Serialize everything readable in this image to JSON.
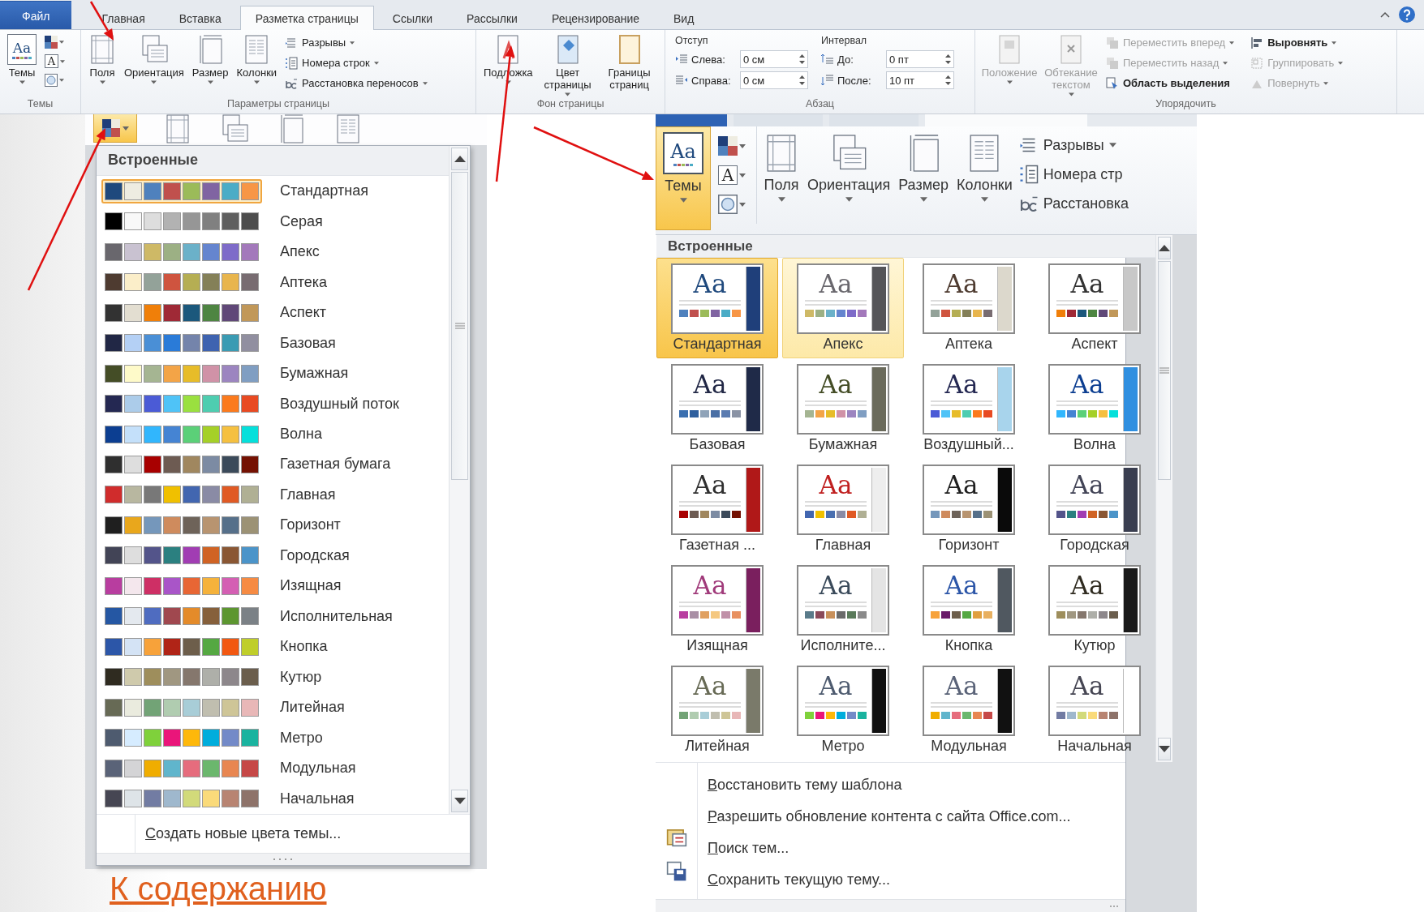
{
  "ribbon": {
    "tabs": [
      {
        "label": "Файл",
        "kind": "file",
        "selected": false
      },
      {
        "label": "Главная",
        "kind": "tab",
        "selected": false
      },
      {
        "label": "Вставка",
        "kind": "tab",
        "selected": false
      },
      {
        "label": "Разметка страницы",
        "kind": "tab",
        "selected": true
      },
      {
        "label": "Ссылки",
        "kind": "tab",
        "selected": false
      },
      {
        "label": "Рассылки",
        "kind": "tab",
        "selected": false
      },
      {
        "label": "Рецензирование",
        "kind": "tab",
        "selected": false
      },
      {
        "label": "Вид",
        "kind": "tab",
        "selected": false
      }
    ],
    "groups": [
      {
        "kind": "themes",
        "label": "Темы",
        "button": {
          "label": "Темы",
          "icon_text": "Aa"
        },
        "font_icon_text": "A"
      },
      {
        "kind": "page_setup",
        "label": "Параметры страницы",
        "big": [
          {
            "label": "Поля",
            "kind": "margins",
            "dropdown": true
          },
          {
            "label": "Ориентация",
            "kind": "orientation",
            "dropdown": true
          },
          {
            "label": "Размер",
            "kind": "size",
            "dropdown": true
          },
          {
            "label": "Колонки",
            "kind": "columns",
            "dropdown": true
          }
        ],
        "small": [
          {
            "label": "Разрывы",
            "kind": "breaks",
            "dropdown": true,
            "disabled": false
          },
          {
            "label": "Номера строк",
            "kind": "line_numbers",
            "dropdown": true,
            "disabled": false
          },
          {
            "label": "Расстановка переносов",
            "kind": "hyphenation",
            "dropdown": true,
            "disabled": false
          }
        ]
      },
      {
        "kind": "background",
        "label": "Фон страницы",
        "big": [
          {
            "label": "Подложка",
            "kind": "watermark",
            "dropdown": true
          },
          {
            "label": "Цвет страницы",
            "kind": "page_color",
            "dropdown": true
          },
          {
            "label": "Границы страниц",
            "kind": "page_borders",
            "dropdown": false
          }
        ]
      },
      {
        "kind": "paragraph",
        "label": "Абзац",
        "indent": {
          "title": "Отступ",
          "fields": [
            {
              "label": "Слева:",
              "kind": "indent_left",
              "value": "0 см"
            },
            {
              "label": "Справа:",
              "kind": "indent_right",
              "value": "0 см"
            }
          ]
        },
        "spacing": {
          "title": "Интервал",
          "fields": [
            {
              "label": "До:",
              "kind": "space_before",
              "value": "0 пт"
            },
            {
              "label": "После:",
              "kind": "space_after",
              "value": "10 пт"
            }
          ]
        }
      },
      {
        "kind": "arrange",
        "label": "Упорядочить",
        "big": [
          {
            "label": "Положение",
            "kind": "position",
            "dropdown": true,
            "disabled": true
          },
          {
            "label": "Обтекание текстом",
            "kind": "wrap",
            "dropdown": true,
            "disabled": true
          }
        ],
        "small": [
          {
            "label": "Переместить вперед",
            "kind": "forward",
            "dropdown": true,
            "disabled": true
          },
          {
            "label": "Переместить назад",
            "kind": "backward",
            "dropdown": true,
            "disabled": true
          },
          {
            "label": "Область выделения",
            "kind": "selection",
            "dropdown": false,
            "disabled": false
          },
          {
            "label": "Выровнять",
            "kind": "align",
            "dropdown": true,
            "disabled": false
          },
          {
            "label": "Группировать",
            "kind": "group",
            "dropdown": true,
            "disabled": true
          },
          {
            "label": "Повернуть",
            "kind": "rotate",
            "dropdown": true,
            "disabled": true
          }
        ]
      }
    ]
  },
  "colors_gallery": {
    "colors_button": {
      "pressed": true
    },
    "heading": "Встроенные",
    "schemes": [
      {
        "name": "Стандартная",
        "selected": true,
        "swatches": [
          {
            "color": "#1f497d"
          },
          {
            "color": "#eeece1"
          },
          {
            "color": "#4f81bd"
          },
          {
            "color": "#c0504d"
          },
          {
            "color": "#9bbb59"
          },
          {
            "color": "#8064a2"
          },
          {
            "color": "#4bacc6"
          },
          {
            "color": "#f79646"
          }
        ]
      },
      {
        "name": "Серая",
        "selected": false,
        "swatches": [
          {
            "color": "#000000"
          },
          {
            "color": "#f8f8f8"
          },
          {
            "color": "#dddddd"
          },
          {
            "color": "#b2b2b2"
          },
          {
            "color": "#969696"
          },
          {
            "color": "#808080"
          },
          {
            "color": "#5f5f5f"
          },
          {
            "color": "#4d4d4d"
          }
        ]
      },
      {
        "name": "Апекс",
        "selected": false,
        "swatches": [
          {
            "color": "#69676d"
          },
          {
            "color": "#c9c2d1"
          },
          {
            "color": "#ceb966"
          },
          {
            "color": "#9cb084"
          },
          {
            "color": "#6bb1c9"
          },
          {
            "color": "#6585cf"
          },
          {
            "color": "#7e6bc9"
          },
          {
            "color": "#a379bb"
          }
        ]
      },
      {
        "name": "Аптека",
        "selected": false,
        "swatches": [
          {
            "color": "#4e3b30"
          },
          {
            "color": "#fbeec9"
          },
          {
            "color": "#93a299"
          },
          {
            "color": "#cf543f"
          },
          {
            "color": "#b5ae53"
          },
          {
            "color": "#848058"
          },
          {
            "color": "#e8b54d"
          },
          {
            "color": "#786c71"
          }
        ]
      },
      {
        "name": "Аспект",
        "selected": false,
        "swatches": [
          {
            "color": "#323232"
          },
          {
            "color": "#e3ded1"
          },
          {
            "color": "#f07f09"
          },
          {
            "color": "#9f2936"
          },
          {
            "color": "#1b587c"
          },
          {
            "color": "#4e8542"
          },
          {
            "color": "#604878"
          },
          {
            "color": "#c19859"
          }
        ]
      },
      {
        "name": "Базовая",
        "selected": false,
        "swatches": [
          {
            "color": "#212745"
          },
          {
            "color": "#b4d0f5"
          },
          {
            "color": "#4a8fd6"
          },
          {
            "color": "#2a7bd8"
          },
          {
            "color": "#7484ab"
          },
          {
            "color": "#3e63b0"
          },
          {
            "color": "#3a9bb3"
          },
          {
            "color": "#918fa0"
          }
        ]
      },
      {
        "name": "Бумажная",
        "selected": false,
        "swatches": [
          {
            "color": "#444d26"
          },
          {
            "color": "#fefac9"
          },
          {
            "color": "#a5b592"
          },
          {
            "color": "#f3a447"
          },
          {
            "color": "#e7bc29"
          },
          {
            "color": "#d092a7"
          },
          {
            "color": "#9c85c0"
          },
          {
            "color": "#809ec2"
          }
        ]
      },
      {
        "name": "Воздушный поток",
        "selected": false,
        "swatches": [
          {
            "color": "#242852"
          },
          {
            "color": "#acccea"
          },
          {
            "color": "#4b5bd6"
          },
          {
            "color": "#4fc3f7"
          },
          {
            "color": "#9ae03f"
          },
          {
            "color": "#4ecdb0"
          },
          {
            "color": "#fb7a1d"
          },
          {
            "color": "#e84a22"
          }
        ]
      },
      {
        "name": "Волна",
        "selected": false,
        "swatches": [
          {
            "color": "#0c3e91"
          },
          {
            "color": "#c4e0fa"
          },
          {
            "color": "#31b6fd"
          },
          {
            "color": "#4584d3"
          },
          {
            "color": "#5bd078"
          },
          {
            "color": "#a5d028"
          },
          {
            "color": "#f5c040"
          },
          {
            "color": "#05e0db"
          }
        ]
      },
      {
        "name": "Газетная бумага",
        "selected": false,
        "swatches": [
          {
            "color": "#2f2f2f"
          },
          {
            "color": "#dedede"
          },
          {
            "color": "#a80000"
          },
          {
            "color": "#6d5b52"
          },
          {
            "color": "#a0875f"
          },
          {
            "color": "#7c8ba3"
          },
          {
            "color": "#3b4a5a"
          },
          {
            "color": "#741102"
          }
        ]
      },
      {
        "name": "Главная",
        "selected": false,
        "swatches": [
          {
            "color": "#d02c2c"
          },
          {
            "color": "#b8b7a0"
          },
          {
            "color": "#787878"
          },
          {
            "color": "#f0c000"
          },
          {
            "color": "#4266b0"
          },
          {
            "color": "#8a8ba5"
          },
          {
            "color": "#e05a24"
          },
          {
            "color": "#b0b094"
          }
        ]
      },
      {
        "name": "Горизонт",
        "selected": false,
        "swatches": [
          {
            "color": "#1f1f1f"
          },
          {
            "color": "#e9a71c"
          },
          {
            "color": "#7597bb"
          },
          {
            "color": "#cf8b5d"
          },
          {
            "color": "#6e6359"
          },
          {
            "color": "#b89470"
          },
          {
            "color": "#56708a"
          },
          {
            "color": "#9c9275"
          }
        ]
      },
      {
        "name": "Городская",
        "selected": false,
        "swatches": [
          {
            "color": "#424456"
          },
          {
            "color": "#dedede"
          },
          {
            "color": "#53548a"
          },
          {
            "color": "#2b8080"
          },
          {
            "color": "#a13db3"
          },
          {
            "color": "#d06324"
          },
          {
            "color": "#8a5734"
          },
          {
            "color": "#4b94c9"
          }
        ]
      },
      {
        "name": "Изящная",
        "selected": false,
        "swatches": [
          {
            "color": "#b83d9f"
          },
          {
            "color": "#f4e7ed"
          },
          {
            "color": "#ce2f65"
          },
          {
            "color": "#a955c8"
          },
          {
            "color": "#e86634"
          },
          {
            "color": "#f5b23b"
          },
          {
            "color": "#d45fb3"
          },
          {
            "color": "#f68b43"
          }
        ]
      },
      {
        "name": "Исполнительная",
        "selected": false,
        "swatches": [
          {
            "color": "#2557a3"
          },
          {
            "color": "#e4e9ef"
          },
          {
            "color": "#4f6cc0"
          },
          {
            "color": "#a0484f"
          },
          {
            "color": "#e48b2a"
          },
          {
            "color": "#86603b"
          },
          {
            "color": "#5d9630"
          },
          {
            "color": "#7b8186"
          }
        ]
      },
      {
        "name": "Кнопка",
        "selected": false,
        "swatches": [
          {
            "color": "#2c56a8"
          },
          {
            "color": "#d4e3f5"
          },
          {
            "color": "#f7a23a"
          },
          {
            "color": "#b02417"
          },
          {
            "color": "#6d5e4b"
          },
          {
            "color": "#55a842"
          },
          {
            "color": "#f25811"
          },
          {
            "color": "#bfce2a"
          }
        ]
      },
      {
        "name": "Кутюр",
        "selected": false,
        "swatches": [
          {
            "color": "#2f2b20"
          },
          {
            "color": "#cfcaac"
          },
          {
            "color": "#9e8e5c"
          },
          {
            "color": "#a09781"
          },
          {
            "color": "#85776d"
          },
          {
            "color": "#aeafa9"
          },
          {
            "color": "#8d878b"
          },
          {
            "color": "#6b5e4d"
          }
        ]
      },
      {
        "name": "Литейная",
        "selected": false,
        "swatches": [
          {
            "color": "#676a55"
          },
          {
            "color": "#eaebde"
          },
          {
            "color": "#72a376"
          },
          {
            "color": "#b0ccb0"
          },
          {
            "color": "#a8cdd7"
          },
          {
            "color": "#c0beaf"
          },
          {
            "color": "#cec597"
          },
          {
            "color": "#e8b7b7"
          }
        ]
      },
      {
        "name": "Метро",
        "selected": false,
        "swatches": [
          {
            "color": "#4e5b6f"
          },
          {
            "color": "#d6ecff"
          },
          {
            "color": "#7fd13b"
          },
          {
            "color": "#ea157a"
          },
          {
            "color": "#feb80a"
          },
          {
            "color": "#00addc"
          },
          {
            "color": "#738ac8"
          },
          {
            "color": "#1ab39f"
          }
        ]
      },
      {
        "name": "Модульная",
        "selected": false,
        "swatches": [
          {
            "color": "#5a6378"
          },
          {
            "color": "#d4d4d6"
          },
          {
            "color": "#f0ad00"
          },
          {
            "color": "#60b5cc"
          },
          {
            "color": "#e66c7d"
          },
          {
            "color": "#6bb76d"
          },
          {
            "color": "#e88651"
          },
          {
            "color": "#c64847"
          }
        ]
      },
      {
        "name": "Начальная",
        "selected": false,
        "swatches": [
          {
            "color": "#464653"
          },
          {
            "color": "#dee4e8"
          },
          {
            "color": "#727ca3"
          },
          {
            "color": "#9fb8cd"
          },
          {
            "color": "#d2da7a"
          },
          {
            "color": "#fada7a"
          },
          {
            "color": "#b88472"
          },
          {
            "color": "#8e736a"
          }
        ]
      }
    ],
    "create_command": "Создать новые цвета темы..."
  },
  "themes_gallery": {
    "ribbon": {
      "tabs": [
        {
          "kind": "file",
          "selected": false
        },
        {
          "kind": "tab",
          "selected": false
        },
        {
          "kind": "tab",
          "selected": false
        },
        {
          "kind": "tab",
          "selected": true
        }
      ],
      "themes_button": {
        "label": "Темы",
        "icon_text": "Aa",
        "pressed": true
      },
      "font_icon_text": "A",
      "big": [
        {
          "label": "Поля",
          "kind": "margins"
        },
        {
          "label": "Ориентация",
          "kind": "orientation"
        },
        {
          "label": "Размер",
          "kind": "size"
        },
        {
          "label": "Колонки",
          "kind": "columns"
        }
      ],
      "small": [
        {
          "label": "Разрывы",
          "kind": "breaks",
          "dropdown": true
        },
        {
          "label": "Номера стр",
          "kind": "line_numbers",
          "dropdown": false
        },
        {
          "label": "Расстановка",
          "kind": "hyphenation",
          "dropdown": false
        }
      ]
    },
    "heading": "Встроенные",
    "themes": [
      {
        "name": "Стандартная",
        "selected": true,
        "hovered": false,
        "sample": {
          "text": "Aa",
          "color": "#1f497d"
        },
        "band": {
          "color": "#1f3f7a"
        },
        "swatches": [
          {
            "color": "#4f81bd"
          },
          {
            "color": "#c0504d"
          },
          {
            "color": "#9bbb59"
          },
          {
            "color": "#8064a2"
          },
          {
            "color": "#4bacc6"
          },
          {
            "color": "#f79646"
          }
        ]
      },
      {
        "name": "Апекс",
        "selected": false,
        "hovered": true,
        "sample": {
          "text": "Aa",
          "color": "#69676d"
        },
        "band": {
          "color": "#555558"
        },
        "swatches": [
          {
            "color": "#ceb966"
          },
          {
            "color": "#9cb084"
          },
          {
            "color": "#6bb1c9"
          },
          {
            "color": "#6585cf"
          },
          {
            "color": "#7e6bc9"
          },
          {
            "color": "#a379bb"
          }
        ]
      },
      {
        "name": "Аптека",
        "selected": false,
        "hovered": false,
        "sample": {
          "text": "Aa",
          "color": "#4e3b30"
        },
        "band": {
          "color": "#dcd8cc"
        },
        "swatches": [
          {
            "color": "#93a299"
          },
          {
            "color": "#cf543f"
          },
          {
            "color": "#b5ae53"
          },
          {
            "color": "#848058"
          },
          {
            "color": "#e8b54d"
          },
          {
            "color": "#786c71"
          }
        ]
      },
      {
        "name": "Аспект",
        "selected": false,
        "hovered": false,
        "sample": {
          "text": "Aa",
          "color": "#323232"
        },
        "band": {
          "color": "#c8c8c8"
        },
        "swatches": [
          {
            "color": "#f07f09"
          },
          {
            "color": "#9f2936"
          },
          {
            "color": "#1b587c"
          },
          {
            "color": "#4e8542"
          },
          {
            "color": "#604878"
          },
          {
            "color": "#c19859"
          }
        ]
      },
      {
        "name": "Базовая",
        "selected": false,
        "hovered": false,
        "sample": {
          "text": "Aa",
          "color": "#212745"
        },
        "band": {
          "color": "#1f2a48"
        },
        "swatches": [
          {
            "color": "#3a6fb0"
          },
          {
            "color": "#2f5f9e"
          },
          {
            "color": "#8fa3b8"
          },
          {
            "color": "#4a6fa5"
          },
          {
            "color": "#5a7bb0"
          },
          {
            "color": "#8a93a5"
          }
        ]
      },
      {
        "name": "Бумажная",
        "selected": false,
        "hovered": false,
        "sample": {
          "text": "Aa",
          "color": "#444d26"
        },
        "band": {
          "color": "#6b6b5c"
        },
        "swatches": [
          {
            "color": "#a5b592"
          },
          {
            "color": "#f3a447"
          },
          {
            "color": "#e7bc29"
          },
          {
            "color": "#d092a7"
          },
          {
            "color": "#9c85c0"
          },
          {
            "color": "#809ec2"
          }
        ]
      },
      {
        "name": "Воздушный...",
        "selected": false,
        "hovered": false,
        "sample": {
          "text": "Aa",
          "color": "#242852"
        },
        "band": {
          "color": "#a8d4ec"
        },
        "swatches": [
          {
            "color": "#4b5bd6"
          },
          {
            "color": "#4fc3f7"
          },
          {
            "color": "#e7bc29"
          },
          {
            "color": "#4ecdb0"
          },
          {
            "color": "#fb7a1d"
          },
          {
            "color": "#e84a22"
          }
        ]
      },
      {
        "name": "Волна",
        "selected": false,
        "hovered": false,
        "sample": {
          "text": "Aa",
          "color": "#0c3e91"
        },
        "band": {
          "color": "#2f8fe0"
        },
        "swatches": [
          {
            "color": "#31b6fd"
          },
          {
            "color": "#4584d3"
          },
          {
            "color": "#5bd078"
          },
          {
            "color": "#a5d028"
          },
          {
            "color": "#f5c040"
          },
          {
            "color": "#05e0db"
          }
        ]
      },
      {
        "name": "Газетная ...",
        "selected": false,
        "hovered": false,
        "sample": {
          "text": "Aa",
          "color": "#2f2f2f"
        },
        "band": {
          "color": "#b01818"
        },
        "swatches": [
          {
            "color": "#a80000"
          },
          {
            "color": "#6d5b52"
          },
          {
            "color": "#a0875f"
          },
          {
            "color": "#7c8ba3"
          },
          {
            "color": "#3b4a5a"
          },
          {
            "color": "#741102"
          }
        ]
      },
      {
        "name": "Главная",
        "selected": false,
        "hovered": false,
        "sample": {
          "text": "Aa",
          "color": "#c02020"
        },
        "band": {
          "color": "#eeeeee"
        },
        "swatches": [
          {
            "color": "#4266b0"
          },
          {
            "color": "#f0c000"
          },
          {
            "color": "#4a6fb0"
          },
          {
            "color": "#8a8ba5"
          },
          {
            "color": "#e05a24"
          },
          {
            "color": "#b0b094"
          }
        ]
      },
      {
        "name": "Горизонт",
        "selected": false,
        "hovered": false,
        "sample": {
          "text": "Aa",
          "color": "#1f1f1f"
        },
        "band": {
          "color": "#0a0a0a"
        },
        "swatches": [
          {
            "color": "#7597bb"
          },
          {
            "color": "#cf8b5d"
          },
          {
            "color": "#6e6359"
          },
          {
            "color": "#b89470"
          },
          {
            "color": "#56708a"
          },
          {
            "color": "#9c9275"
          }
        ]
      },
      {
        "name": "Городская",
        "selected": false,
        "hovered": false,
        "sample": {
          "text": "Aa",
          "color": "#424456"
        },
        "band": {
          "color": "#3a3e50"
        },
        "swatches": [
          {
            "color": "#53548a"
          },
          {
            "color": "#2b8080"
          },
          {
            "color": "#a13db3"
          },
          {
            "color": "#d06324"
          },
          {
            "color": "#8a5734"
          },
          {
            "color": "#4b94c9"
          }
        ]
      },
      {
        "name": "Изящная",
        "selected": false,
        "hovered": false,
        "sample": {
          "text": "Aa",
          "color": "#a03a7a"
        },
        "band": {
          "color": "#7a1f5e"
        },
        "swatches": [
          {
            "color": "#b83d9f"
          },
          {
            "color": "#a98fa5"
          },
          {
            "color": "#e0a060"
          },
          {
            "color": "#f5c880"
          },
          {
            "color": "#c090a8"
          },
          {
            "color": "#e89060"
          }
        ]
      },
      {
        "name": "Исполните...",
        "selected": false,
        "hovered": false,
        "sample": {
          "text": "Aa",
          "color": "#3a4a5a"
        },
        "band": {
          "color": "#e4e4e4"
        },
        "swatches": [
          {
            "color": "#5a7b8a"
          },
          {
            "color": "#8a4a5a"
          },
          {
            "color": "#c8905a"
          },
          {
            "color": "#6a6a6a"
          },
          {
            "color": "#5a7a5a"
          },
          {
            "color": "#8a8a8a"
          }
        ]
      },
      {
        "name": "Кнопка",
        "selected": false,
        "hovered": false,
        "sample": {
          "text": "Aa",
          "color": "#2c56a8"
        },
        "band": {
          "color": "#505860"
        },
        "swatches": [
          {
            "color": "#f7a23a"
          },
          {
            "color": "#6a1a6a"
          },
          {
            "color": "#6d5e4b"
          },
          {
            "color": "#55a842"
          },
          {
            "color": "#e0a040"
          },
          {
            "color": "#e8b060"
          }
        ]
      },
      {
        "name": "Кутюр",
        "selected": false,
        "hovered": false,
        "sample": {
          "text": "Aa",
          "color": "#2f2b20"
        },
        "band": {
          "color": "#1a1a1a"
        },
        "swatches": [
          {
            "color": "#9e8e5c"
          },
          {
            "color": "#a09781"
          },
          {
            "color": "#85776d"
          },
          {
            "color": "#aeafa9"
          },
          {
            "color": "#8d878b"
          },
          {
            "color": "#6b5e4d"
          }
        ]
      },
      {
        "name": "Литейная",
        "selected": false,
        "hovered": false,
        "sample": {
          "text": "Aa",
          "color": "#676a55"
        },
        "band": {
          "color": "#7a7a6a"
        },
        "swatches": [
          {
            "color": "#72a376"
          },
          {
            "color": "#b0ccb0"
          },
          {
            "color": "#a8cdd7"
          },
          {
            "color": "#c0beaf"
          },
          {
            "color": "#cec597"
          },
          {
            "color": "#e8b7b7"
          }
        ]
      },
      {
        "name": "Метро",
        "selected": false,
        "hovered": false,
        "sample": {
          "text": "Aa",
          "color": "#4e5b6f"
        },
        "band": {
          "color": "#101010"
        },
        "swatches": [
          {
            "color": "#7fd13b"
          },
          {
            "color": "#ea157a"
          },
          {
            "color": "#feb80a"
          },
          {
            "color": "#00addc"
          },
          {
            "color": "#738ac8"
          },
          {
            "color": "#1ab39f"
          }
        ]
      },
      {
        "name": "Модульная",
        "selected": false,
        "hovered": false,
        "sample": {
          "text": "Aa",
          "color": "#5a6378"
        },
        "band": {
          "color": "#111111"
        },
        "swatches": [
          {
            "color": "#f0ad00"
          },
          {
            "color": "#60b5cc"
          },
          {
            "color": "#e66c7d"
          },
          {
            "color": "#6bb76d"
          },
          {
            "color": "#e88651"
          },
          {
            "color": "#c64847"
          }
        ]
      },
      {
        "name": "Начальная",
        "selected": false,
        "hovered": false,
        "sample": {
          "text": "Aa",
          "color": "#464653"
        },
        "band": {
          "color": "#ffffff"
        },
        "swatches": [
          {
            "color": "#727ca3"
          },
          {
            "color": "#9fb8cd"
          },
          {
            "color": "#d2da7a"
          },
          {
            "color": "#fada7a"
          },
          {
            "color": "#b88472"
          },
          {
            "color": "#8e736a"
          }
        ]
      }
    ],
    "commands": [
      {
        "label": "Восстановить тему шаблона",
        "kind": "plain"
      },
      {
        "label": "Разрешить обновление контента с сайта Office.com...",
        "kind": "plain"
      },
      {
        "label": "Поиск тем...",
        "kind": "browse"
      },
      {
        "label": "Сохранить текущую тему...",
        "kind": "save"
      }
    ]
  },
  "link": {
    "label": "К содержанию"
  }
}
